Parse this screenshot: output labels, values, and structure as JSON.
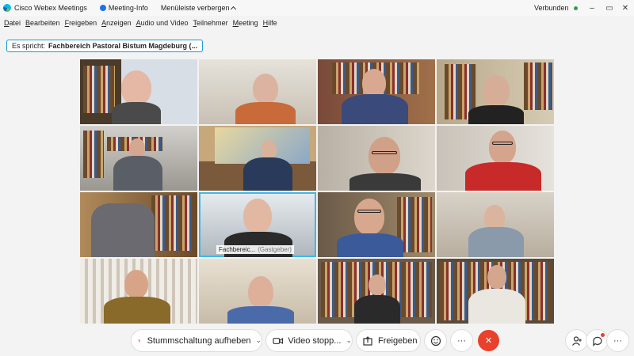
{
  "window": {
    "app_title": "Cisco Webex Meetings",
    "meeting_info": "Meeting-Info",
    "hide_menu": "Menüleiste verbergen",
    "status": "Verbunden",
    "controls": {
      "minimize": "–",
      "restore": "▭",
      "close": "✕"
    }
  },
  "menu": [
    "Datei",
    "Bearbeiten",
    "Freigeben",
    "Anzeigen",
    "Audio und Video",
    "Teilnehmer",
    "Meeting",
    "Hilfe"
  ],
  "speaker": {
    "prefix": "Es spricht:",
    "name": "Fachbereich Pastoral Bistum Magdeburg (..."
  },
  "host_tile": {
    "name": "Fachbereic...",
    "role": "(Gastgeber)"
  },
  "toolbar": {
    "mute": "Stummschaltung aufheben",
    "video": "Video stopp...",
    "share": "Freigeben",
    "more": "···",
    "end": "✕",
    "overflow": "···"
  },
  "colors": {
    "accent": "#1a9bd7",
    "end": "#e8412c",
    "connected": "#2ea043"
  }
}
